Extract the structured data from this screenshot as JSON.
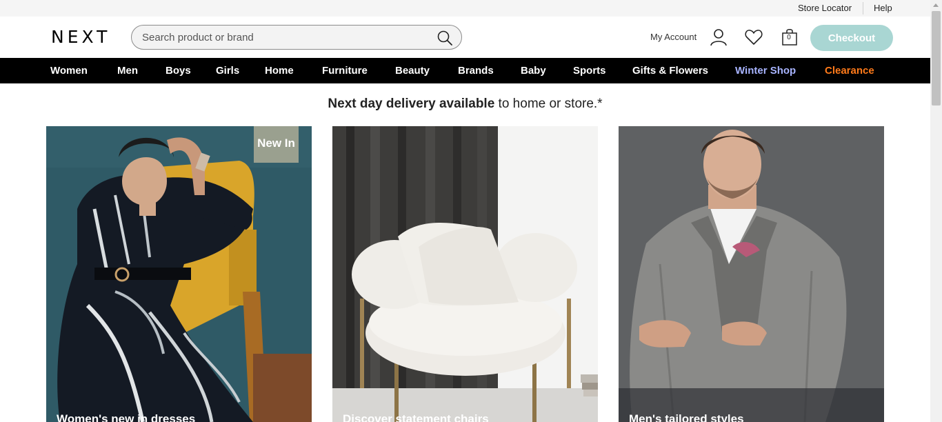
{
  "utility": {
    "store_locator": "Store Locator",
    "help": "Help"
  },
  "header": {
    "logo": "NEXT",
    "search_placeholder": "Search product or brand",
    "account_label": "My Account",
    "bag_count": "0",
    "checkout_label": "Checkout",
    "icons": [
      "search-icon",
      "account-icon",
      "heart-icon",
      "bag-icon"
    ]
  },
  "nav": {
    "items": [
      {
        "label": "Women",
        "color": "#ffffff"
      },
      {
        "label": "Men",
        "color": "#ffffff"
      },
      {
        "label": "Boys",
        "color": "#ffffff"
      },
      {
        "label": "Girls",
        "color": "#ffffff"
      },
      {
        "label": "Home",
        "color": "#ffffff"
      },
      {
        "label": "Furniture",
        "color": "#ffffff"
      },
      {
        "label": "Beauty",
        "color": "#ffffff"
      },
      {
        "label": "Brands",
        "color": "#ffffff"
      },
      {
        "label": "Baby",
        "color": "#ffffff"
      },
      {
        "label": "Sports",
        "color": "#ffffff"
      },
      {
        "label": "Gifts & Flowers",
        "color": "#ffffff"
      },
      {
        "label": "Winter Shop",
        "color": "#a8b4ff"
      },
      {
        "label": "Clearance",
        "color": "#ff7a1a"
      }
    ]
  },
  "promo": {
    "bold": "Next day delivery available",
    "rest": " to home or store.*"
  },
  "tiles": [
    {
      "caption": "Women's new in dresses",
      "badge": "New In"
    },
    {
      "caption": "Discover statement chairs"
    },
    {
      "caption": "Men's tailored styles"
    }
  ],
  "colors": {
    "checkout_bg": "#a9d6d3",
    "navbar_bg": "#000000",
    "winter_shop": "#a8b4ff",
    "clearance": "#ff7a1a"
  }
}
